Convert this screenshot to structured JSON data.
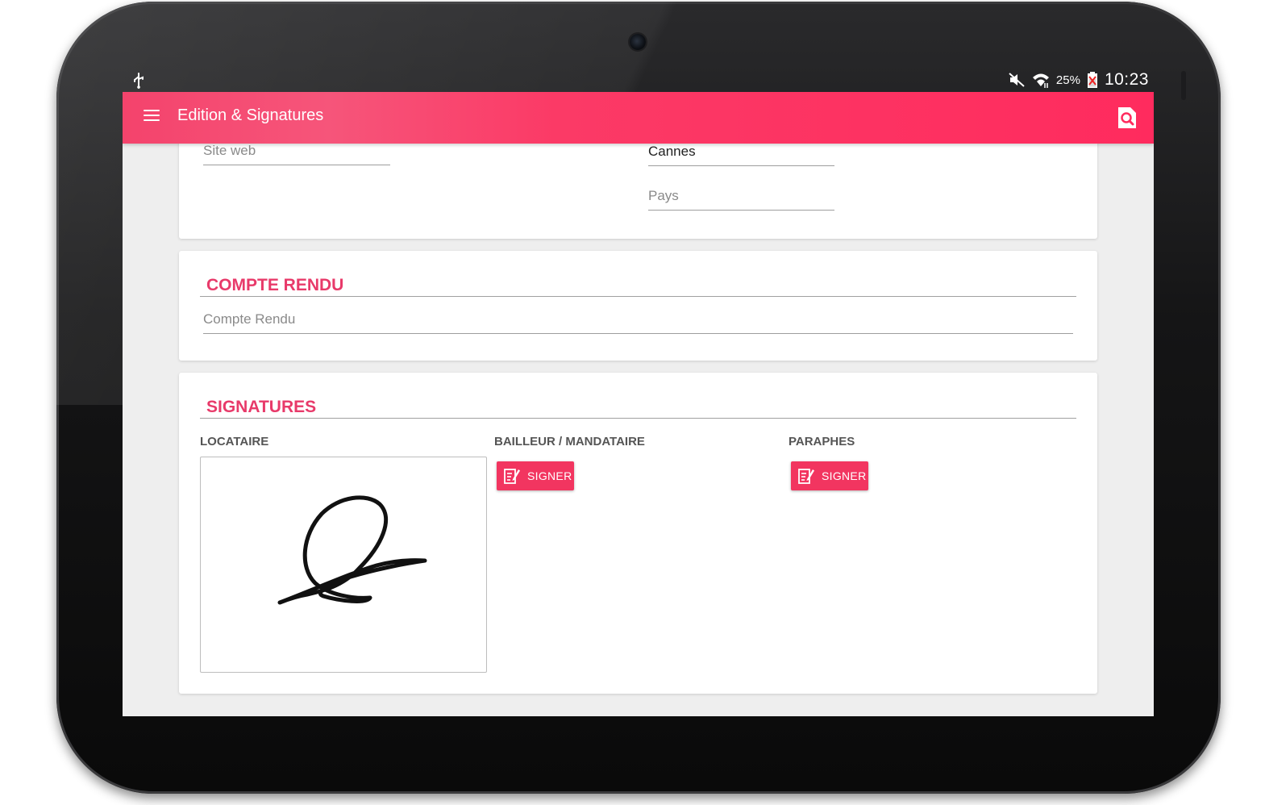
{
  "status_bar": {
    "battery_pct": "25%",
    "time": "10:23"
  },
  "app_bar": {
    "title": "Edition & Signatures",
    "menu_icon": "hamburger-menu-icon",
    "action_icon": "document-preview-icon"
  },
  "address_card": {
    "site_web": {
      "value": "",
      "placeholder": "Site web"
    },
    "ville": {
      "value": "Cannes",
      "placeholder": ""
    },
    "pays": {
      "value": "",
      "placeholder": "Pays"
    }
  },
  "compte_rendu": {
    "title": "COMPTE RENDU",
    "field": {
      "value": "",
      "placeholder": "Compte Rendu"
    }
  },
  "signatures": {
    "title": "SIGNATURES",
    "locataire": {
      "label": "LOCATAIRE"
    },
    "bailleur": {
      "label": "BAILLEUR / MANDATAIRE",
      "button": "SIGNER"
    },
    "paraphes": {
      "label": "PARAPHES",
      "button": "SIGNER"
    }
  },
  "colors": {
    "accent": "#ff2b5e",
    "section_title": "#e83a6a",
    "button": "#f23560"
  }
}
